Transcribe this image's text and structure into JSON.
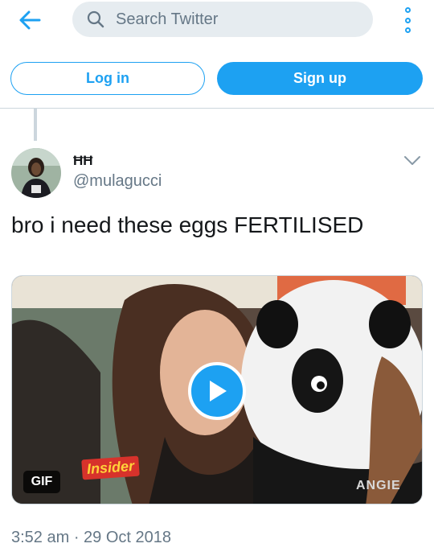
{
  "header": {
    "back_icon": "arrow-left-icon",
    "search": {
      "placeholder": "Search Twitter",
      "value": "",
      "icon": "search-icon"
    },
    "more_icon": "vertical-dots-icon"
  },
  "auth": {
    "login_label": "Log in",
    "signup_label": "Sign up"
  },
  "tweet": {
    "display_name": "ĦĦ",
    "handle": "@mulagucci",
    "text": "bro i need these eggs FERTILISED",
    "media": {
      "type_badge": "GIF",
      "overlay_logo": "Insider",
      "watermark": "ANGIE"
    },
    "timestamp": "3:52 am · 29 Oct 2018"
  },
  "colors": {
    "accent": "#1da1f2",
    "secondary_text": "#657786",
    "border": "#ccd6dd",
    "search_bg": "#e6ecf0"
  }
}
